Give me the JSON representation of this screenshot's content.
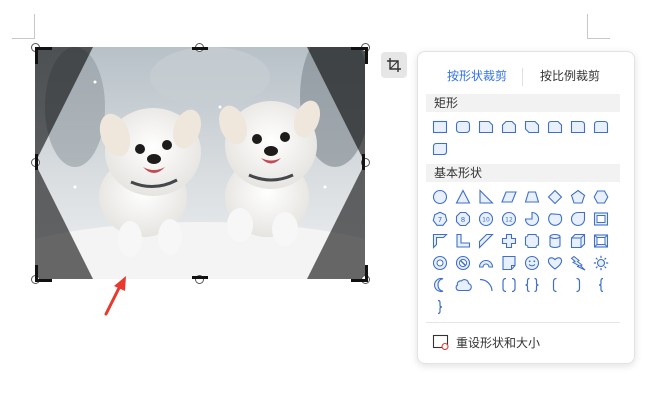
{
  "crop_panel": {
    "tabs": [
      {
        "label": "按形状裁剪",
        "active": true
      },
      {
        "label": "按比例裁剪",
        "active": false
      }
    ],
    "sections": {
      "rectangles": "矩形",
      "basic_shapes": "基本形状"
    },
    "shape_numbers": [
      "7",
      "8",
      "10",
      "12"
    ],
    "reset_label": "重设形状和大小"
  },
  "colors": {
    "accent": "#3173e6",
    "arrow": "#e8392f",
    "shape_stroke": "#3f6fc9",
    "shape_fill": "#e8f0fd"
  },
  "icons": {
    "crop_tool": "crop-icon",
    "reset": "reset-shape-icon",
    "annotation": "red-arrow-icon"
  }
}
